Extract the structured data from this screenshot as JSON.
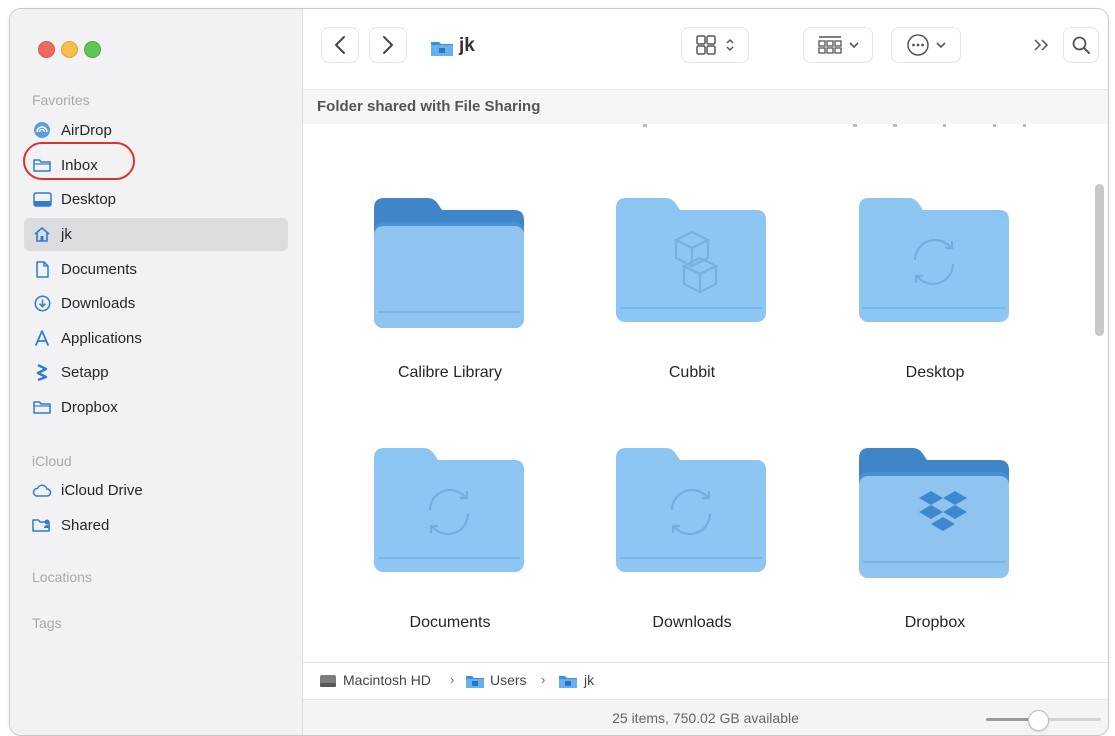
{
  "window": {
    "title": "jk"
  },
  "sidebar": {
    "sections": {
      "favorites": "Favorites",
      "icloud": "iCloud",
      "locations": "Locations",
      "tags": "Tags"
    },
    "favorites": [
      {
        "label": "AirDrop",
        "icon": "airdrop-icon"
      },
      {
        "label": "Inbox",
        "icon": "folder-icon"
      },
      {
        "label": "Desktop",
        "icon": "desktop-icon"
      },
      {
        "label": "jk",
        "icon": "home-icon",
        "selected": true
      },
      {
        "label": "Documents",
        "icon": "document-icon"
      },
      {
        "label": "Downloads",
        "icon": "download-icon"
      },
      {
        "label": "Applications",
        "icon": "applications-icon"
      },
      {
        "label": "Setapp",
        "icon": "setapp-icon"
      },
      {
        "label": "Dropbox",
        "icon": "folder-icon"
      }
    ],
    "icloud": [
      {
        "label": "iCloud Drive",
        "icon": "cloud-icon"
      },
      {
        "label": "Shared",
        "icon": "shared-folder-icon"
      }
    ]
  },
  "toolbar": {
    "back_icon": "chevron-left-icon",
    "forward_icon": "chevron-right-icon",
    "title": "jk",
    "view_icon": "icon-grid-icon",
    "group_icon": "group-grid-icon",
    "more_icon": "ellipsis-circle-icon",
    "overflow_icon": "double-chevron-right-icon",
    "search_icon": "search-icon"
  },
  "banner": {
    "text": "Folder shared with File Sharing"
  },
  "items": [
    {
      "name": "Calibre Library",
      "style": "plain-dark"
    },
    {
      "name": "Cubbit",
      "style": "cubes"
    },
    {
      "name": "Desktop",
      "style": "sync"
    },
    {
      "name": "Documents",
      "style": "sync"
    },
    {
      "name": "Downloads",
      "style": "sync"
    },
    {
      "name": "Dropbox",
      "style": "dropbox"
    }
  ],
  "pathbar": {
    "segments": [
      {
        "label": "Macintosh HD",
        "icon": "hard-drive-icon"
      },
      {
        "label": "Users",
        "icon": "folder-icon"
      },
      {
        "label": "jk",
        "icon": "home-folder-icon"
      }
    ],
    "separator": "›"
  },
  "status": {
    "text": "25 items, 750.02 GB available"
  },
  "zoom": {
    "level": 0.45
  },
  "colors": {
    "folder": "#8cc5f2",
    "folder_dark": "#5fa3da",
    "annotation": "#d9352b",
    "selection": "#dcdcde"
  }
}
